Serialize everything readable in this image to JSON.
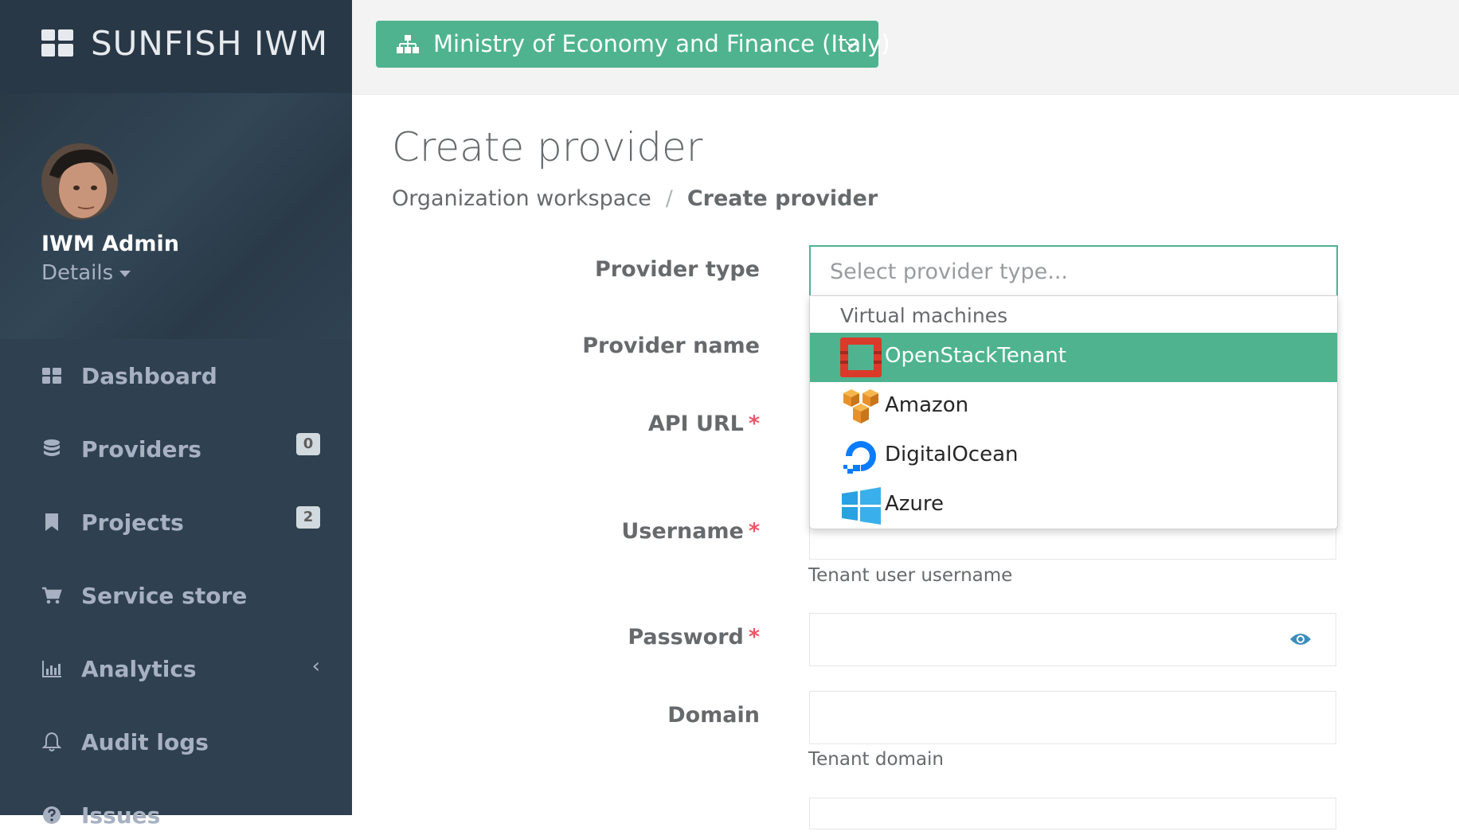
{
  "brand": {
    "title": "SUNFISH IWM"
  },
  "user": {
    "name": "IWM Admin",
    "details_label": "Details"
  },
  "nav": {
    "items": [
      {
        "label": "Dashboard",
        "icon": "dashboard-icon"
      },
      {
        "label": "Providers",
        "icon": "database-icon",
        "badge": "0"
      },
      {
        "label": "Projects",
        "icon": "bookmark-icon",
        "badge": "2"
      },
      {
        "label": "Service store",
        "icon": "cart-icon"
      },
      {
        "label": "Analytics",
        "icon": "bar-chart-icon",
        "chevron": "‹"
      },
      {
        "label": "Audit logs",
        "icon": "bell-icon"
      },
      {
        "label": "Issues",
        "icon": "question-icon"
      }
    ]
  },
  "org": {
    "label": "Ministry of Economy and Finance (Italy)",
    "icon": "sitemap-icon"
  },
  "page": {
    "title": "Create provider"
  },
  "breadcrumb": {
    "parent": "Organization workspace",
    "separator": "/",
    "current": "Create provider"
  },
  "form": {
    "provider_type": {
      "label": "Provider type",
      "placeholder": "Select provider type..."
    },
    "provider_name": {
      "label": "Provider name"
    },
    "api_url": {
      "label": "API URL",
      "required": "*"
    },
    "username": {
      "label": "Username",
      "required": "*",
      "help": "Tenant user username"
    },
    "password": {
      "label": "Password",
      "required": "*"
    },
    "domain": {
      "label": "Domain",
      "help": "Tenant domain"
    }
  },
  "dropdown": {
    "group": "Virtual machines",
    "options": [
      {
        "label": "OpenStackTenant",
        "icon": "openstack-icon",
        "selected": true
      },
      {
        "label": "Amazon",
        "icon": "amazon-icon",
        "selected": false
      },
      {
        "label": "DigitalOcean",
        "icon": "digitalocean-icon",
        "selected": false
      },
      {
        "label": "Azure",
        "icon": "azure-icon",
        "selected": false
      }
    ]
  },
  "colors": {
    "sidebar": "#2f4050",
    "accent": "#4fb390",
    "required": "#ed5565",
    "badge": "#d1dade"
  }
}
